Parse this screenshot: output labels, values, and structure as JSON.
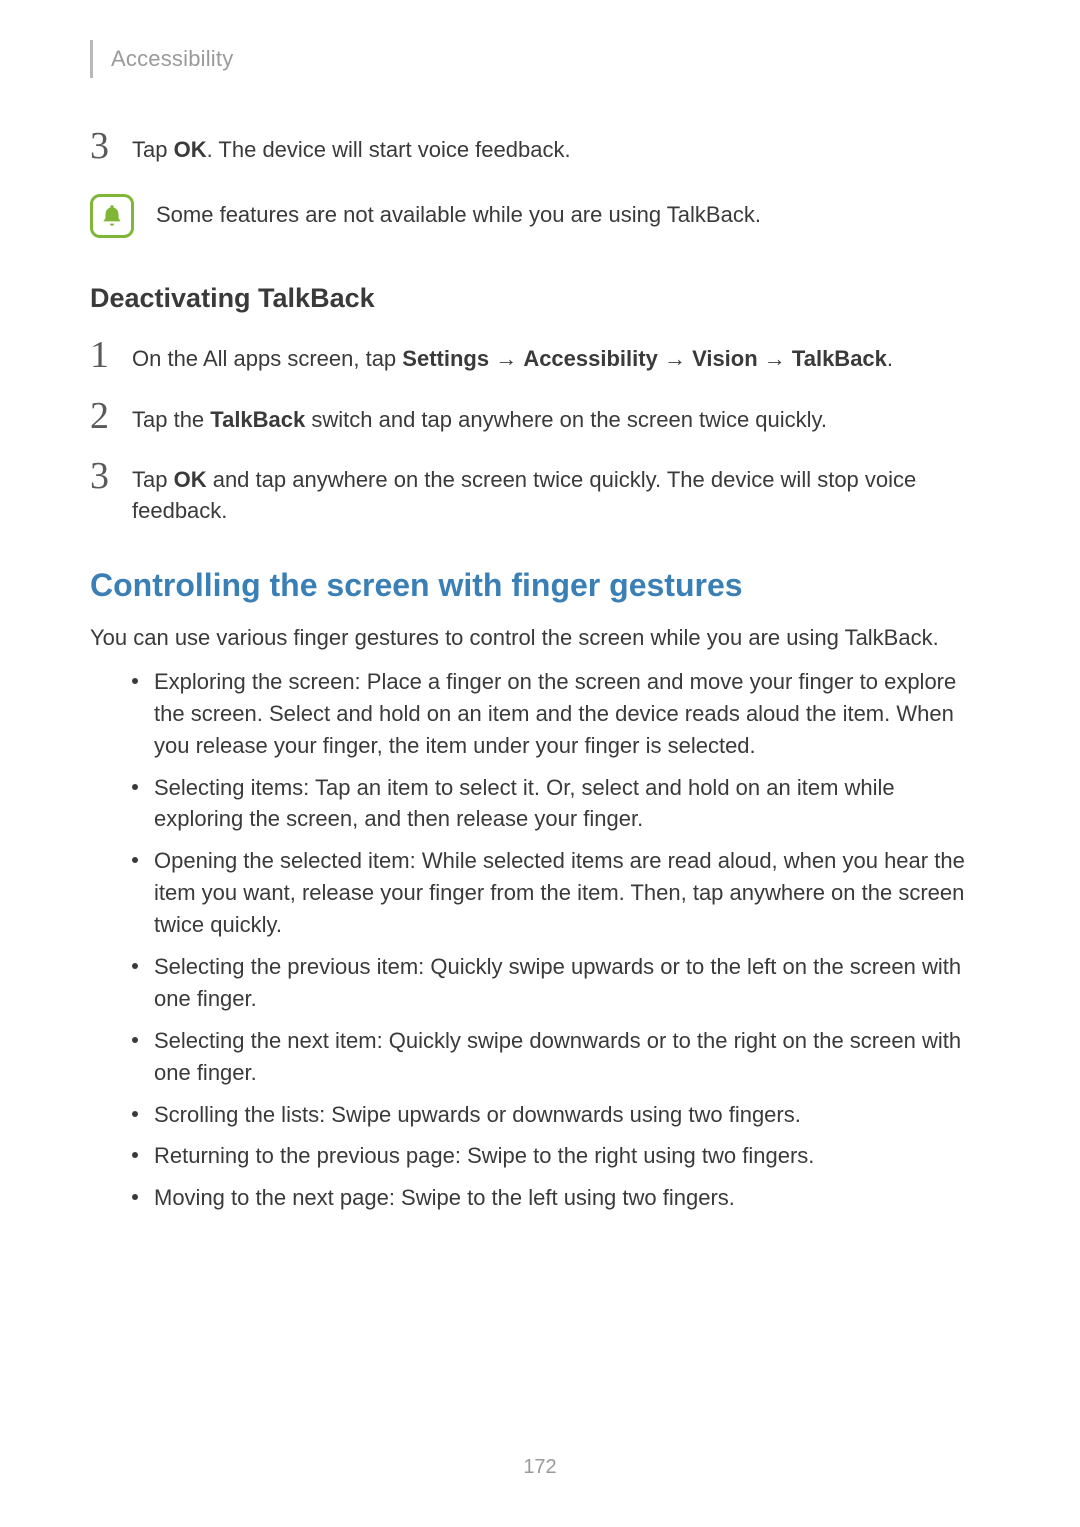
{
  "header": {
    "title": "Accessibility"
  },
  "step3a": {
    "num": "3",
    "pre": "Tap ",
    "bold": "OK",
    "post": ". The device will start voice feedback."
  },
  "note": {
    "text": "Some features are not available while you are using TalkBack."
  },
  "subheading": "Deactivating TalkBack",
  "step1": {
    "num": "1",
    "pre": "On the All apps screen, tap ",
    "b1": "Settings",
    "a1": " → ",
    "b2": "Accessibility",
    "a2": " → ",
    "b3": "Vision",
    "a3": " → ",
    "b4": "TalkBack",
    "post": "."
  },
  "step2": {
    "num": "2",
    "pre": "Tap the ",
    "bold": "TalkBack",
    "post": " switch and tap anywhere on the screen twice quickly."
  },
  "step3b": {
    "num": "3",
    "pre": "Tap ",
    "bold": "OK",
    "post": " and tap anywhere on the screen twice quickly. The device will stop voice feedback."
  },
  "section": {
    "heading": "Controlling the screen with finger gestures",
    "intro": "You can use various finger gestures to control the screen while you are using TalkBack."
  },
  "bullets": [
    "Exploring the screen: Place a finger on the screen and move your finger to explore the screen. Select and hold on an item and the device reads aloud the item. When you release your finger, the item under your finger is selected.",
    "Selecting items: Tap an item to select it. Or, select and hold on an item while exploring the screen, and then release your finger.",
    "Opening the selected item: While selected items are read aloud, when you hear the item you want, release your finger from the item. Then, tap anywhere on the screen twice quickly.",
    "Selecting the previous item: Quickly swipe upwards or to the left on the screen with one finger.",
    "Selecting the next item: Quickly swipe downwards or to the right on the screen with one finger.",
    "Scrolling the lists: Swipe upwards or downwards using two fingers.",
    "Returning to the previous page: Swipe to the right using two fingers.",
    "Moving to the next page: Swipe to the left using two fingers."
  ],
  "pageNumber": "172"
}
